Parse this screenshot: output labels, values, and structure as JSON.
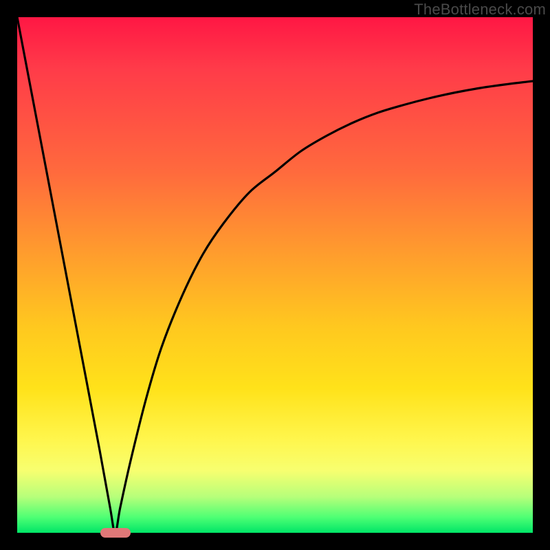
{
  "watermark": "TheBottleneck.com",
  "colors": {
    "background": "#000000",
    "gradient_top": "#ff1744",
    "gradient_mid1": "#ff9a2e",
    "gradient_mid2": "#ffe21a",
    "gradient_bottom": "#00e567",
    "curve_stroke": "#000000",
    "marker_fill": "#e07878"
  },
  "chart_data": {
    "type": "line",
    "title": "",
    "xlabel": "",
    "ylabel": "",
    "xlim": [
      0,
      100
    ],
    "ylim": [
      0,
      100
    ],
    "grid": false,
    "legend": false,
    "notes": "V-shaped bottleneck curve. Left branch descends steeply from top-left to minimum at x≈19, right branch rises with decreasing slope toward x=100. Higher y = worse (red), y≈0 = good (green).",
    "minimum_x": 19,
    "series": [
      {
        "name": "bottleneck-curve",
        "x": [
          0,
          4,
          8,
          12,
          16,
          18,
          19,
          20,
          22,
          25,
          28,
          32,
          36,
          40,
          45,
          50,
          55,
          60,
          65,
          70,
          75,
          80,
          85,
          90,
          95,
          100
        ],
        "y": [
          100,
          79,
          58,
          37,
          16,
          5,
          0,
          5,
          14,
          26,
          36,
          46,
          54,
          60,
          66,
          70,
          74,
          77,
          79.5,
          81.5,
          83,
          84.3,
          85.4,
          86.3,
          87,
          87.6
        ]
      }
    ],
    "marker": {
      "x": 19,
      "y": 0,
      "shape": "pill"
    }
  }
}
